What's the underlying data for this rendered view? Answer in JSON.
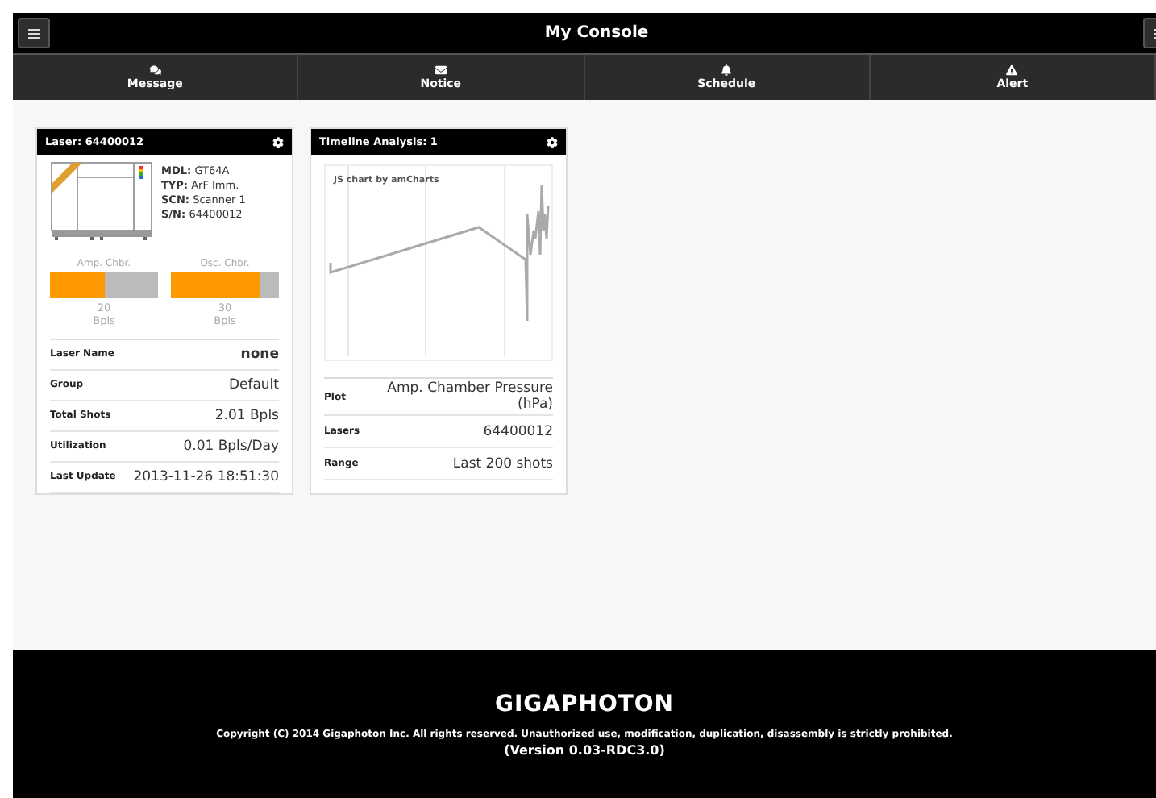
{
  "header": {
    "title": "My Console"
  },
  "nav": [
    {
      "label": "Message",
      "kind": "chat"
    },
    {
      "label": "Notice",
      "kind": "mail"
    },
    {
      "label": "Schedule",
      "kind": "bell"
    },
    {
      "label": "Alert",
      "kind": "warning"
    }
  ],
  "laser_card": {
    "title": "Laser: 64400012",
    "specs": [
      {
        "key": "MDL:",
        "value": "GT64A"
      },
      {
        "key": "TYP:",
        "value": "ArF Imm."
      },
      {
        "key": "SCN:",
        "value": "Scanner 1"
      },
      {
        "key": "S/N:",
        "value": "64400012"
      }
    ],
    "meters": [
      {
        "label": "Amp. Chbr.",
        "level": 0.5,
        "value": "20",
        "unit": "Bpls"
      },
      {
        "label": "Osc. Chbr.",
        "level": 0.82,
        "value": "30",
        "unit": "Bpls"
      }
    ],
    "rows": [
      {
        "label": "Laser Name",
        "value": "none",
        "bold": true
      },
      {
        "label": "Group",
        "value": "Default",
        "bold": false
      },
      {
        "label": "Total Shots",
        "value": "2.01 Bpls",
        "bold": false
      },
      {
        "label": "Utilization",
        "value": "0.01 Bpls/Day",
        "bold": false
      },
      {
        "label": "Last Update",
        "value": "2013-11-26 18:51:30",
        "bold": false
      }
    ]
  },
  "timeline_card": {
    "title": "Timeline Analysis: 1",
    "chart_credit": "JS chart by amCharts",
    "rows": [
      {
        "label": "Plot",
        "value": "Amp. Chamber Pressure (hPa)"
      },
      {
        "label": "Lasers",
        "value": "64400012"
      },
      {
        "label": "Range",
        "value": "Last 200 shots"
      }
    ]
  },
  "footer": {
    "logo": "GIGAPHOTON",
    "copyright": "Copyright (C) 2014 Gigaphoton Inc. All rights reserved. Unauthorized use, modification, duplication, disassembly is strictly prohibited.",
    "version": "(Version 0.03-RDC3.0)"
  }
}
